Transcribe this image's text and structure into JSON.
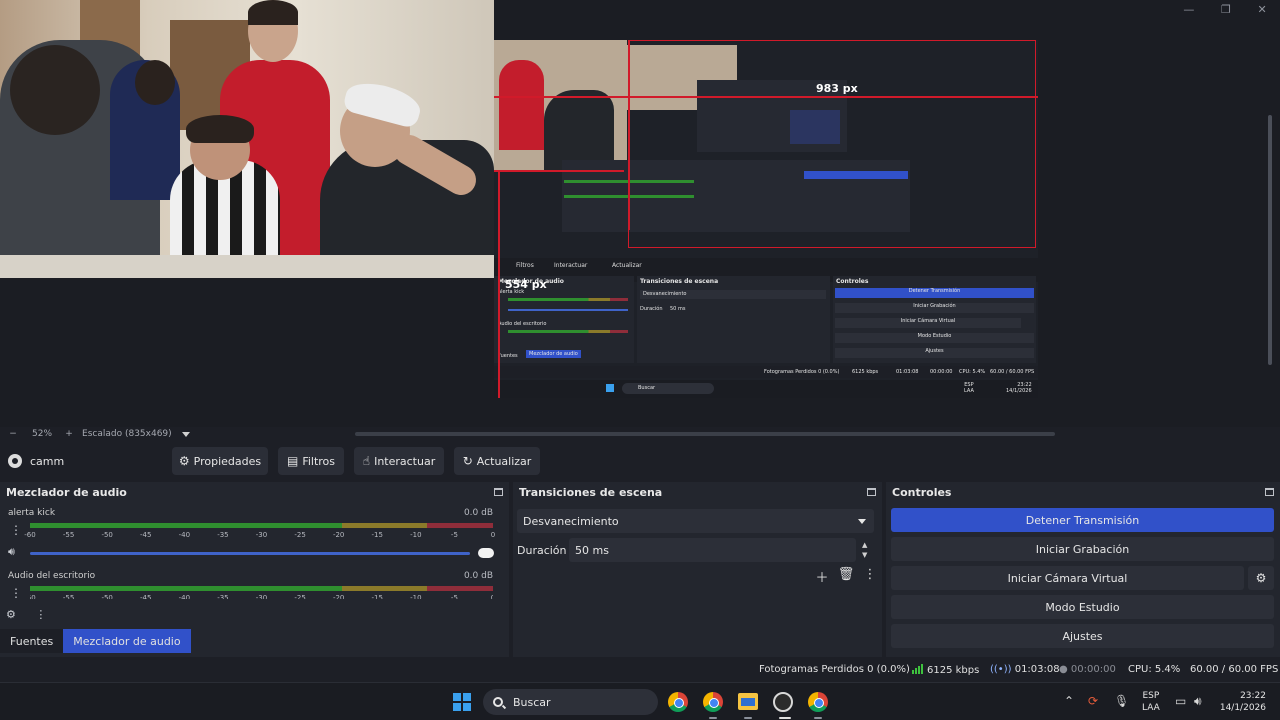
{
  "window": {
    "minimize_icon": "minimize-icon",
    "maximize_icon": "maximize-icon",
    "close_icon": "close-icon"
  },
  "preview": {
    "annotations": {
      "width_label": "983 px",
      "height_label": "554 px"
    },
    "nested": {
      "tabs": [
        "Filtros",
        "Interactuar",
        "Actualizar"
      ],
      "mixer_title": "Mezclador de audio",
      "channels": [
        "alerta kick",
        "Audio del escritorio"
      ],
      "db": "0.0 dB",
      "transitions_title": "Transiciones de escena",
      "transition": "Desvanecimiento",
      "duration_label": "Duración",
      "duration": "50 ms",
      "controls_title": "Controles",
      "controls": [
        "Detener Transmisión",
        "Iniciar Grabación",
        "Iniciar Cámara Virtual",
        "Modo Estudio",
        "Ajustes"
      ],
      "tabs_bottom": [
        "Fuentes",
        "Mezclador de audio"
      ],
      "status": "Fotogramas Perdidos 0 (0.0%)",
      "kbps": "6125 kbps",
      "time1": "01:03:08",
      "time2": "00:00:00",
      "cpu": "CPU: 5.4%",
      "fps": "60.00 / 60.00 FPS",
      "search": "Buscar",
      "lang1": "ESP",
      "lang2": "LAA",
      "clock_time": "23:22",
      "clock_date": "14/1/2026"
    }
  },
  "preview_bar": {
    "zoom_out": "−",
    "zoom": "52%",
    "zoom_in": "+",
    "scale": "Escalado (835x469)"
  },
  "source_toolbar": {
    "source_name": "camm",
    "properties": "Propiedades",
    "filters": "Filtros",
    "interact": "Interactuar",
    "refresh": "Actualizar"
  },
  "audio_mixer": {
    "title": "Mezclador de audio",
    "ticks": [
      "-60",
      "-55",
      "-50",
      "-45",
      "-40",
      "-35",
      "-30",
      "-25",
      "-20",
      "-15",
      "-10",
      "-5",
      "0"
    ],
    "channels": [
      {
        "name": "alerta kick",
        "db": "0.0 dB",
        "volume_fraction": 1.0
      },
      {
        "name": "Audio del escritorio",
        "db": "0.0 dB"
      }
    ]
  },
  "bottom_tabs": {
    "sources": "Fuentes",
    "mixer": "Mezclador de audio"
  },
  "transitions": {
    "title": "Transiciones de escena",
    "selected": "Desvanecimiento",
    "duration_label": "Duración",
    "duration_value": "50 ms"
  },
  "controls": {
    "title": "Controles",
    "stop_stream": "Detener Transmisión",
    "start_recording": "Iniciar Grabación",
    "start_virtual_cam": "Iniciar Cámara Virtual",
    "studio_mode": "Modo Estudio",
    "settings": "Ajustes"
  },
  "status_bar": {
    "dropped_frames": "Fotogramas Perdidos 0 (0.0%)",
    "bitrate": "6125 kbps",
    "stream_time": "01:03:08",
    "record_time": "00:00:00",
    "cpu": "CPU: 5.4%",
    "fps": "60.00 / 60.00 FPS"
  },
  "taskbar": {
    "search_placeholder": "Buscar",
    "lang_line1": "ESP",
    "lang_line2": "LAA",
    "time": "23:22",
    "date": "14/1/2026"
  },
  "colors": {
    "accent": "#3151c9",
    "meter_green": "#2f8f2f",
    "meter_yellow": "#8b7a2a",
    "meter_red": "#8f2d3a",
    "annotation_red": "#d11a2a",
    "panel_bg": "#23262e"
  }
}
